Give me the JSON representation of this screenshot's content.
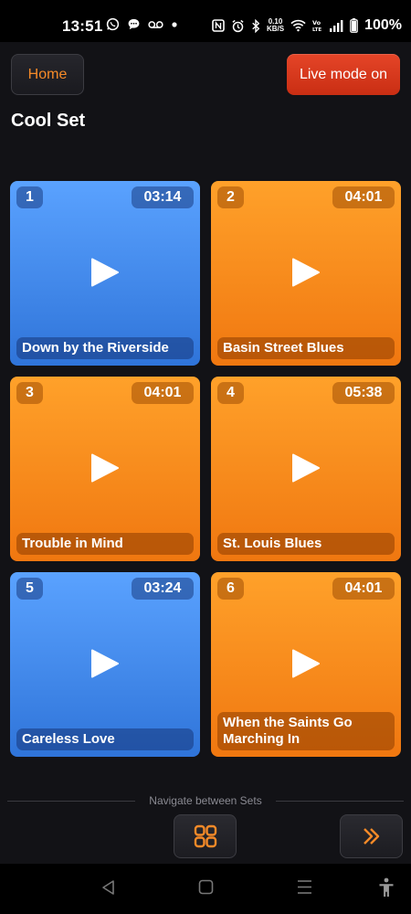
{
  "status_bar": {
    "time": "13:51",
    "net_speed_value": "0.10",
    "net_speed_unit": "KB/S",
    "battery": "100%",
    "icons": [
      "whatsapp-icon",
      "chat-icon",
      "voicemail-icon",
      "dot-icon",
      "nfc-icon",
      "alarm-icon",
      "bluetooth-icon",
      "wifi-icon",
      "volte-icon",
      "signal-icon",
      "battery-icon"
    ]
  },
  "header": {
    "home_label": "Home",
    "live_label": "Live mode on",
    "set_title": "Cool Set"
  },
  "colors": {
    "blue_card": "#3d86ee",
    "orange_card": "#f7891a",
    "live_button": "#d93a1d",
    "accent": "#f58a28"
  },
  "songs": [
    {
      "number": "1",
      "duration": "03:14",
      "title": "Down by the Riverside",
      "color": "blue"
    },
    {
      "number": "2",
      "duration": "04:01",
      "title": "Basin Street Blues",
      "color": "orange"
    },
    {
      "number": "3",
      "duration": "04:01",
      "title": "Trouble in Mind",
      "color": "orange"
    },
    {
      "number": "4",
      "duration": "05:38",
      "title": "St. Louis Blues",
      "color": "orange"
    },
    {
      "number": "5",
      "duration": "03:24",
      "title": "Careless Love",
      "color": "blue"
    },
    {
      "number": "6",
      "duration": "04:01",
      "title": "When the Saints Go Marching In",
      "color": "orange"
    }
  ],
  "navigation": {
    "caption": "Navigate between Sets",
    "grid_icon": "grid-icon",
    "next_icon": "double-chevron-right-icon"
  },
  "system_nav": {
    "icons": [
      "back-icon",
      "home-icon",
      "recents-icon",
      "accessibility-icon"
    ]
  }
}
